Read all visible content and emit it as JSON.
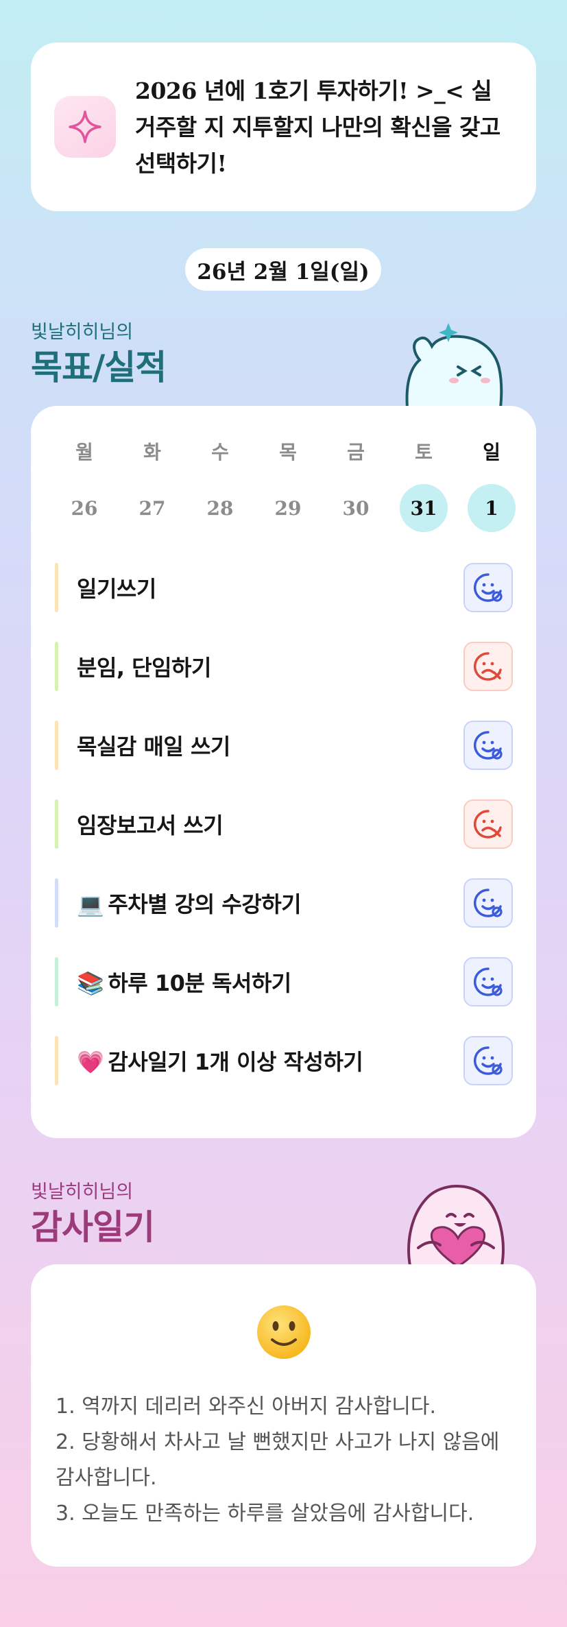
{
  "goal": {
    "icon": "sparkle-icon",
    "text": "2026 년에 1호기 투자하기! >_< 실거주할 지 지투할지 나만의 확신을 갖고 선택하기!"
  },
  "date_label": "26년 2월 1일(일)",
  "goals_section": {
    "subtitle": "빛날히히님의",
    "title": "목표/실적",
    "title_color": "#1f6f7a"
  },
  "week": {
    "days": [
      {
        "label": "월",
        "num": "26",
        "active": false
      },
      {
        "label": "화",
        "num": "27",
        "active": false
      },
      {
        "label": "수",
        "num": "28",
        "active": false
      },
      {
        "label": "목",
        "num": "29",
        "active": false
      },
      {
        "label": "금",
        "num": "30",
        "active": false
      },
      {
        "label": "토",
        "num": "31",
        "active": true
      },
      {
        "label": "일",
        "num": "1",
        "active": true
      }
    ]
  },
  "tasks": [
    {
      "emoji": "",
      "label": "일기쓰기",
      "status": "done",
      "bar_color": "#fbe3b8"
    },
    {
      "emoji": "",
      "label": "분임, 단임하기",
      "status": "missed",
      "bar_color": "#d7f1b4"
    },
    {
      "emoji": "",
      "label": "목실감 매일 쓰기",
      "status": "done",
      "bar_color": "#fbe3b8"
    },
    {
      "emoji": "",
      "label": "임장보고서 쓰기",
      "status": "missed",
      "bar_color": "#d7f1b4"
    },
    {
      "emoji": "💻",
      "label": "주차별 강의 수강하기",
      "status": "done",
      "bar_color": "#d4ddf8"
    },
    {
      "emoji": "📚",
      "label": "하루 10분 독서하기",
      "status": "done",
      "bar_color": "#c6f0dc"
    },
    {
      "emoji": "💗",
      "label": "감사일기 1개 이상 작성하기",
      "status": "done",
      "bar_color": "#fbe3b8"
    }
  ],
  "status_icons": {
    "done": "smile-check-icon",
    "missed": "frown-x-icon"
  },
  "thanks_section": {
    "subtitle": "빛날히히님의",
    "title": "감사일기",
    "title_color": "#9b3b7a"
  },
  "thanks": {
    "emoji": "🙂",
    "items": [
      "1. 역까지 데리러 와주신 아버지 감사합니다.",
      "2. 당황해서 차사고 날 뻔했지만 사고가 나지 않음에 감사합니다.",
      "3. 오늘도 만족하는 하루를 살았음에 감사합니다."
    ]
  }
}
